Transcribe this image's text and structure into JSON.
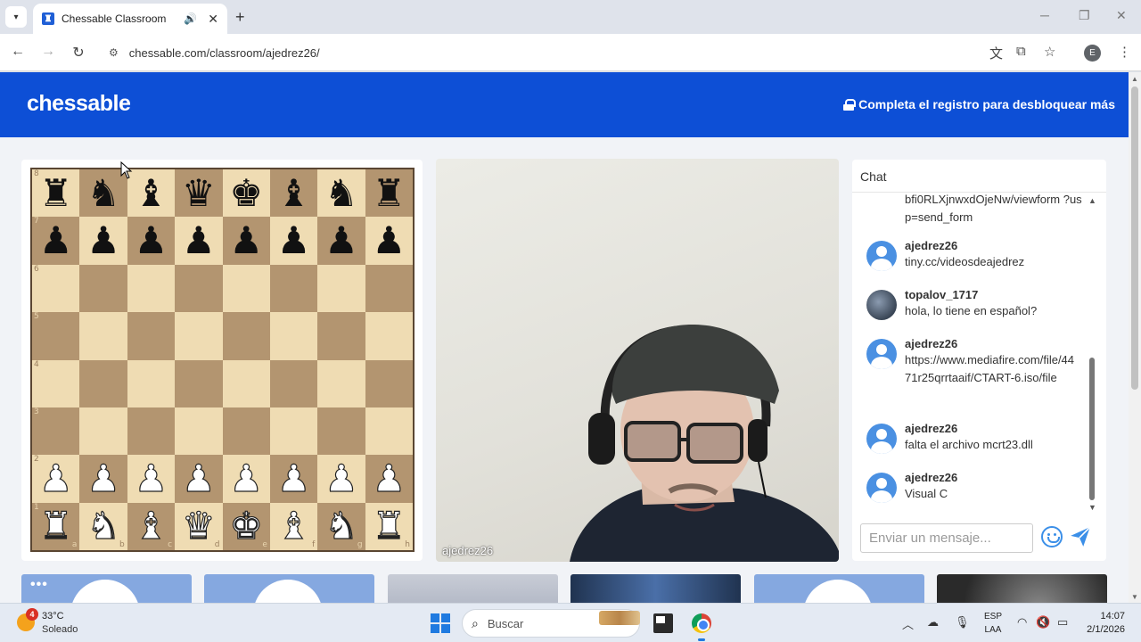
{
  "browser": {
    "tab_title": "Chessable Classroom",
    "url": "chessable.com/classroom/ajedrez26/",
    "profile_initial": "E"
  },
  "site": {
    "logo": "chessable",
    "register_text": "Completa el registro para desbloquear más",
    "brand_color": "#0d4fd6"
  },
  "board": {
    "ranks": [
      "8",
      "7",
      "6",
      "5",
      "4",
      "3",
      "2",
      "1"
    ],
    "files": [
      "a",
      "b",
      "c",
      "d",
      "e",
      "f",
      "g",
      "h"
    ],
    "rows": [
      [
        "♜",
        "♞",
        "♝",
        "♛",
        "♚",
        "♝",
        "♞",
        "♜"
      ],
      [
        "♟",
        "♟",
        "♟",
        "♟",
        "♟",
        "♟",
        "♟",
        "♟"
      ],
      [
        "",
        "",
        "",
        "",
        "",
        "",
        "",
        ""
      ],
      [
        "",
        "",
        "",
        "",
        "",
        "",
        "",
        ""
      ],
      [
        "",
        "",
        "",
        "",
        "",
        "",
        "",
        ""
      ],
      [
        "",
        "",
        "",
        "",
        "",
        "",
        "",
        ""
      ],
      [
        "♙",
        "♙",
        "♙",
        "♙",
        "♙",
        "♙",
        "♙",
        "♙"
      ],
      [
        "♖",
        "♘",
        "♗",
        "♕",
        "♔",
        "♗",
        "♘",
        "♖"
      ]
    ]
  },
  "video": {
    "participant_name": "ajedrez26"
  },
  "chat": {
    "title": "Chat",
    "messages": [
      {
        "user": "",
        "text": "bfi0RLXjnwxdOjeNw/viewform ?usp=send_form",
        "avatar": "none"
      },
      {
        "user": "ajedrez26",
        "text": "tiny.cc/videosdeajedrez",
        "avatar": "default"
      },
      {
        "user": "topalov_1717",
        "text": "hola, lo tiene en español?",
        "avatar": "photo"
      },
      {
        "user": "ajedrez26",
        "text": "https://www.mediafire.com/file/4471r25qrrtaaif/CTART-6.iso/file",
        "avatar": "default"
      },
      {
        "user": "ajedrez26",
        "text": "falta el archivo mcrt23.dll",
        "avatar": "default"
      },
      {
        "user": "ajedrez26",
        "text": "Visual C",
        "avatar": "default"
      }
    ],
    "input_placeholder": "Enviar un mensaje..."
  },
  "taskbar": {
    "weather_badge": "4",
    "temperature": "33°C",
    "weather_desc": "Soleado",
    "search_label": "Buscar",
    "lang_top": "ESP",
    "lang_bottom": "LAA",
    "time": "14:07",
    "date": "2/1/2026"
  }
}
